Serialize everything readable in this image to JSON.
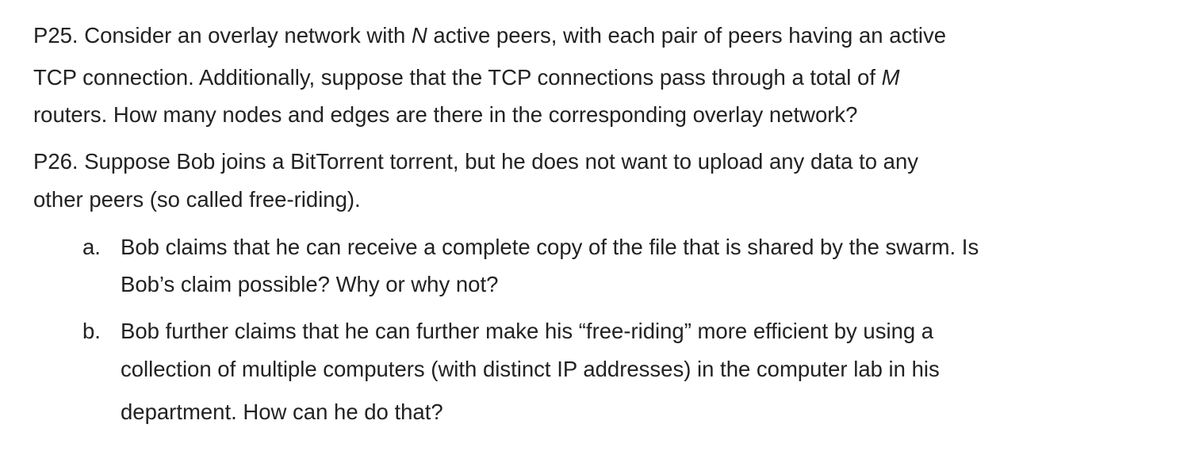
{
  "p25": {
    "l1_a": "P25. Consider an overlay network with ",
    "var_n": "N",
    "l1_b": " active peers, with each pair of peers having an active",
    "l2_a": "TCP connection. Additionally, suppose that the TCP connections pass through a total of ",
    "var_m": "M",
    "l3": "routers. How many nodes and edges are there in the corresponding overlay network?"
  },
  "p26": {
    "l1": "P26. Suppose Bob joins a BitTorrent torrent, but he does not want to upload any data to any",
    "l2": "other peers (so called free-riding).",
    "items": [
      {
        "marker": "a.",
        "lines": [
          "Bob claims that he can receive a complete copy of the file that is shared by the swarm. Is",
          "Bob’s claim possible? Why or why not?"
        ]
      },
      {
        "marker": "b.",
        "lines": [
          "Bob further claims that he can further make his “free-riding” more efficient by using a",
          "collection of multiple computers (with distinct IP addresses) in the computer lab in his",
          "department. How can he do that?"
        ]
      }
    ]
  }
}
